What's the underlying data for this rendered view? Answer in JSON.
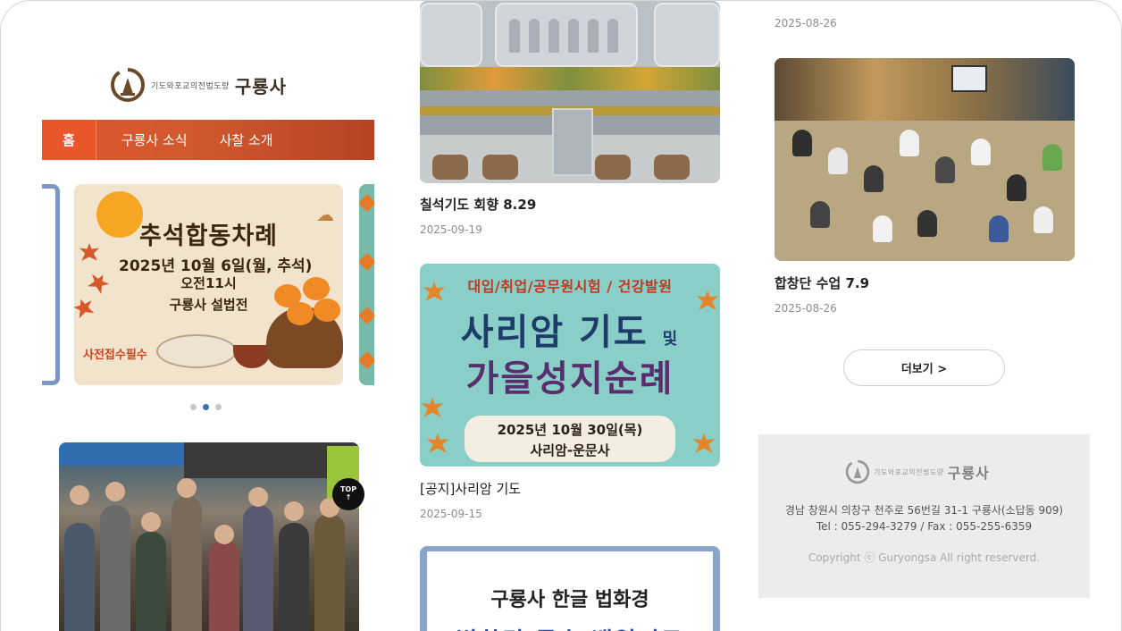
{
  "brand": {
    "sub": "기도와포교의전법도량",
    "name": "구룡사"
  },
  "nav": {
    "items": [
      "홈",
      "구룡사 소식",
      "사찰 소개"
    ]
  },
  "slider": {
    "slide": {
      "title": "추석합동차례",
      "line1": "2025년 10월 6일(월, 추석)",
      "line2": "오전11시",
      "line3": "구룡사 설법전",
      "note": "사전접수필수"
    },
    "dots": 3,
    "active_dot": 1
  },
  "top_button": {
    "label": "TOP",
    "arrow": "↑"
  },
  "posts": {
    "partial_top_date": "2025-08-26",
    "p1": {
      "title": "칠석기도 회향 8.29",
      "date": "2025-09-19"
    },
    "p2": {
      "title": "[공지]사리암 기도",
      "date": "2025-09-15",
      "poster": {
        "top": "대입/취업/공무원시험 / 건강발원",
        "big1": "사리암 기도",
        "big1_suffix": "및",
        "big2": "가을성지순례",
        "date": "2025년 10월 30일(목)",
        "place": "사리암-운문사"
      }
    },
    "p3": {
      "title": "합창단 수업 7.9",
      "date": "2025-08-26"
    },
    "p4": {
      "poster": {
        "title": "구룡사 한글 법화경",
        "cut": "법화경 독송 백일기도"
      }
    }
  },
  "more_button": "더보기 >",
  "footer": {
    "address": "경남 창원시 의창구 천주로 56번길 31-1 구룡사(소답동 909)",
    "tel": "Tel : 055-294-3279 / Fax : 055-255-6359",
    "copyright": "Copyright ⓒ Guryongsa All right reserverd."
  },
  "colors": {
    "nav_start": "#e2552c",
    "nav_end": "#b54323",
    "active_dot": "#3a6fb5",
    "poster_teal": "#89cfc7"
  },
  "icons": [
    "temple-logo-icon",
    "maple-leaf-icon",
    "persimmon-icon",
    "cloud-icon",
    "arrow-up-icon"
  ]
}
